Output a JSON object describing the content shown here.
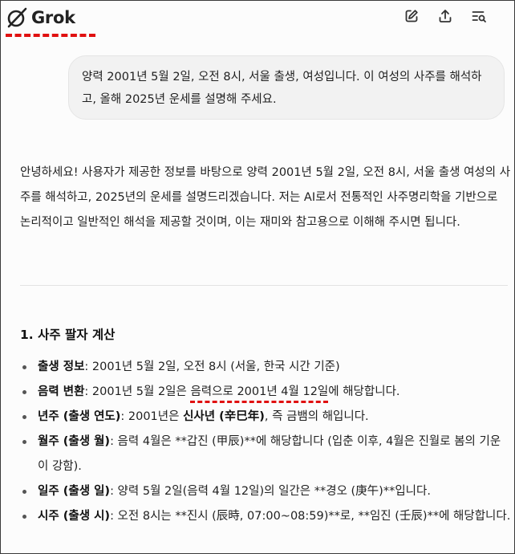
{
  "header": {
    "brand": "Grok",
    "icons": [
      "edit-icon",
      "share-icon",
      "history-search-icon"
    ]
  },
  "user_message": "양력 2001년 5월 2일, 오전 8시, 서울 출생, 여성입니다. 이 여성의 사주를 해석하고, 올해 2025년 운세를 설명해 주세요.",
  "assistant": {
    "intro": "안녕하세요! 사용자가 제공한 정보를 바탕으로 양력 2001년 5월 2일, 오전 8시, 서울 출생 여성의 사주를 해석하고, 2025년의 운세를 설명드리겠습니다. 저는 AI로서 전통적인 사주명리학을 기반으로 논리적이고 일반적인 해석을 제공할 것이며, 이는 재미와 참고용으로 이해해 주시면 됩니다.",
    "section_title": "1. 사주 팔자 계산",
    "items": [
      {
        "label": "출생 정보",
        "text": ": 2001년 5월 2일, 오전 8시 (서울, 한국 시간 기준)"
      },
      {
        "label": "음력 변환",
        "text_before": ": 2001년 5월 2일은 ",
        "text_highlight": "음력으로 2001년 4월 12일",
        "text_after": "에 해당합니다."
      },
      {
        "label": "년주 (출생 연도)",
        "text_before": ": 2001년은 ",
        "text_bold": "신사년 (辛巳年)",
        "text_after": ", 즉 금뱀의 해입니다."
      },
      {
        "label": "월주 (출생 월)",
        "text": ": 음력 4월은 **갑진 (甲辰)**에 해당합니다 (입춘 이후, 4월은 진월로 봄의 기운이 강함)."
      },
      {
        "label": "일주 (출생 일)",
        "text": ": 양력 5월 2일(음력 4월 12일)의 일간은 **경오 (庚午)**입니다."
      },
      {
        "label": "시주 (출생 시)",
        "text": ": 오전 8시는 **진시 (辰時, 07:00~08:59)**로, **임진 (壬辰)**에 해당합니다."
      }
    ]
  },
  "colors": {
    "annotation_red": "#e01010",
    "bubble_bg": "#f2f2f2",
    "page_bg": "#fcfcfc"
  }
}
